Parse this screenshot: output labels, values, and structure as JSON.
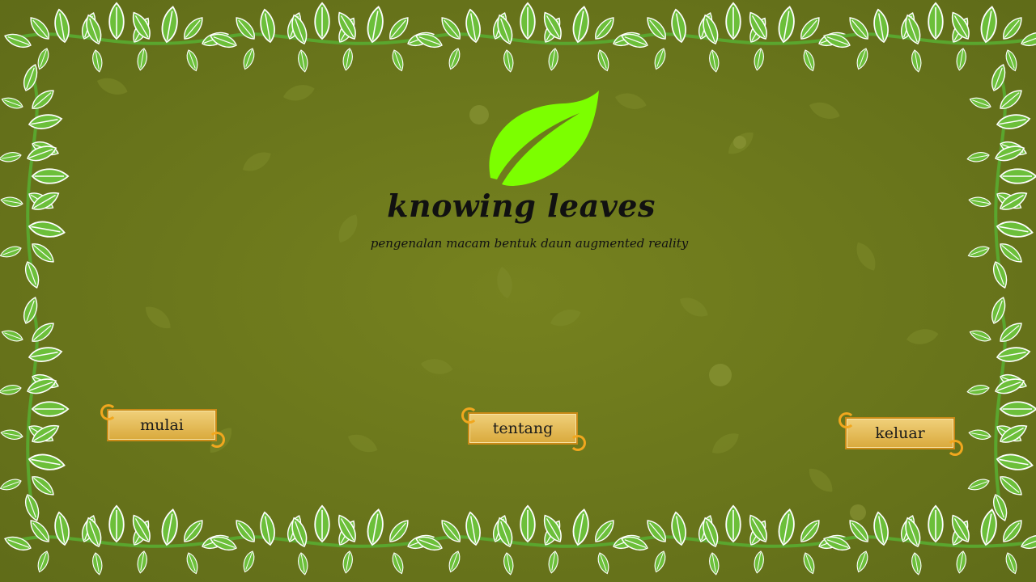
{
  "title": "knowing leaves",
  "subtitle": "pengenalan macam bentuk daun augmented reality",
  "buttons": {
    "start": "mulai",
    "about": "tentang",
    "exit": "keluar"
  },
  "colors": {
    "background": "#6e7a1e",
    "logo_leaf": "#7cff00",
    "border_leaf": "#6cbf3a",
    "button_fill": "#e7bf5c",
    "button_border": "#c98a17"
  },
  "icons": {
    "logo": "leaf-icon",
    "border": "leaf-vine-border",
    "button_ornament": "scroll-curl-ornament"
  }
}
